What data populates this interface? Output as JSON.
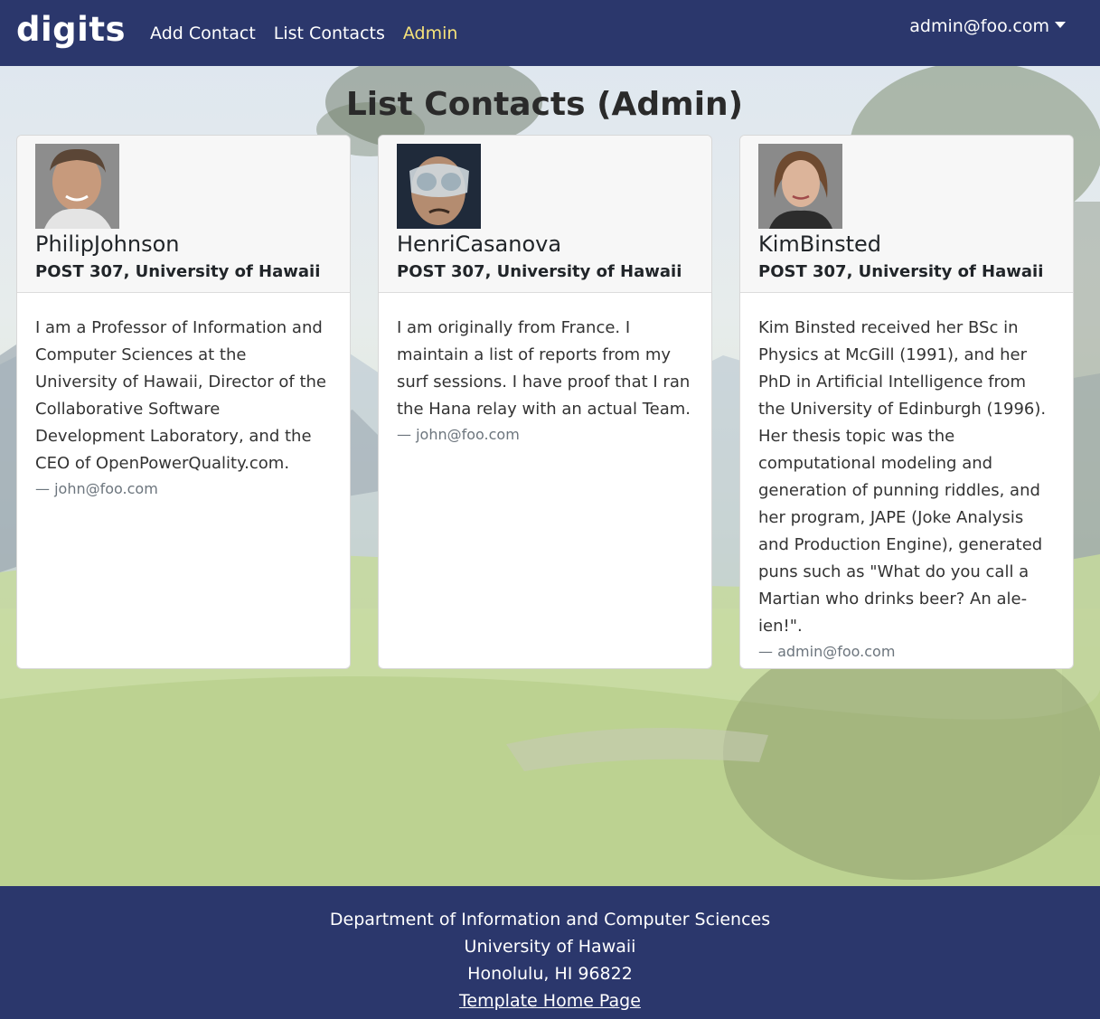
{
  "navbar": {
    "brand": "digits",
    "links": [
      {
        "label": "Add Contact"
      },
      {
        "label": "List Contacts"
      },
      {
        "label": "Admin"
      }
    ],
    "user": "admin@foo.com"
  },
  "page": {
    "title": "List Contacts (Admin)"
  },
  "contacts": [
    {
      "name": "PhilipJohnson",
      "address": "POST 307, University of Hawaii",
      "description": "I am a Professor of Information and Computer Sciences at the University of Hawaii, Director of the Collaborative Software Development Laboratory, and the CEO of OpenPowerQuality.com.",
      "owner": "— john@foo.com"
    },
    {
      "name": "HenriCasanova",
      "address": "POST 307, University of Hawaii",
      "description": "I am originally from France. I maintain a list of reports from my surf sessions. I have proof that I ran the Hana relay with an actual Team.",
      "owner": "— john@foo.com"
    },
    {
      "name": "KimBinsted",
      "address": "POST 307, University of Hawaii",
      "description": "Kim Binsted received her BSc in Physics at McGill (1991), and her PhD in Artificial Intelligence from the University of Edinburgh (1996). Her thesis topic was the computational modeling and generation of punning riddles, and her program, JAPE (Joke Analysis and Production Engine), generated puns such as \"What do you call a Martian who drinks beer? An ale-ien!\".",
      "owner": "— admin@foo.com"
    }
  ],
  "footer": {
    "line1": "Department of Information and Computer Sciences",
    "line2": "University of Hawaii",
    "line3": "Honolulu, HI 96822",
    "link": "Template Home Page"
  },
  "colors": {
    "navbar_bg": "#2b376c",
    "active_link": "#f5e27a"
  }
}
